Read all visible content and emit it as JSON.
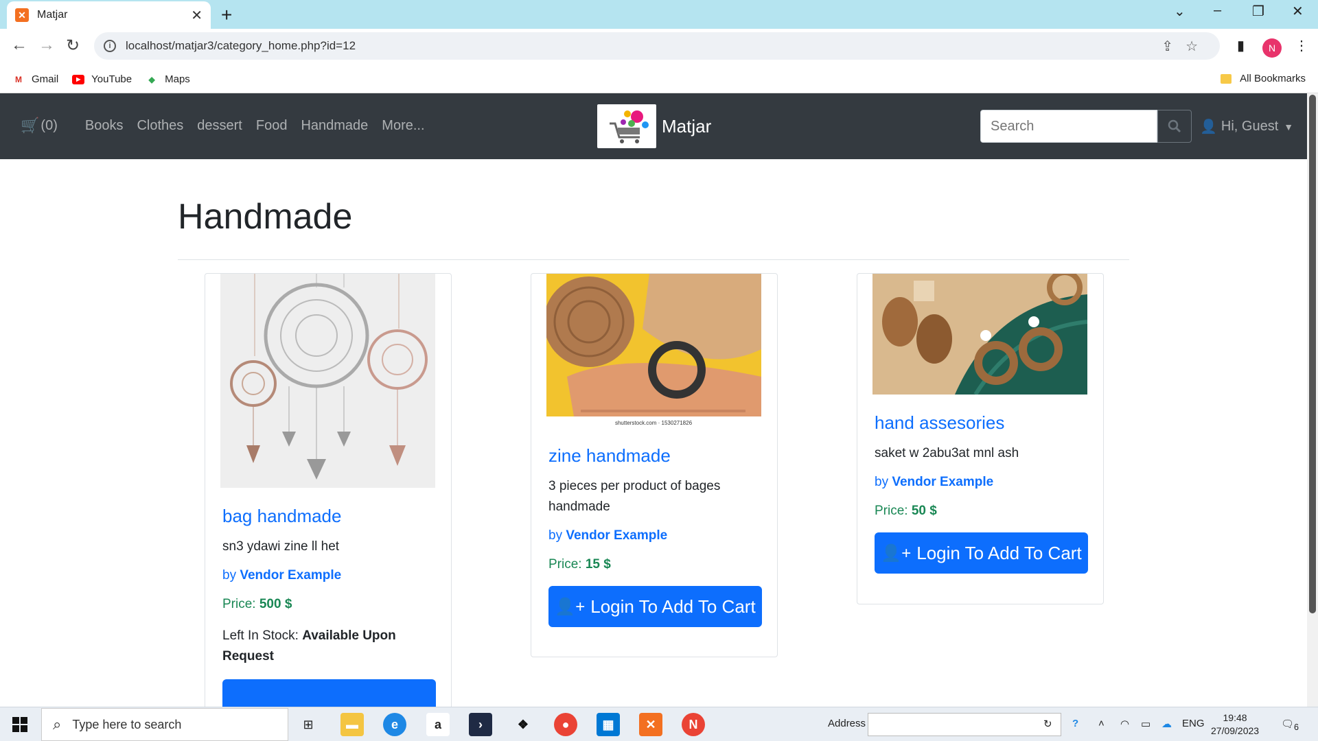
{
  "browser": {
    "tab_title": "Matjar",
    "url": "localhost/matjar3/category_home.php?id=12",
    "bookmarks": [
      {
        "label": "Gmail",
        "icon": "gmail-icon"
      },
      {
        "label": "YouTube",
        "icon": "youtube-icon"
      },
      {
        "label": "Maps",
        "icon": "maps-icon"
      }
    ],
    "all_bookmarks": "All Bookmarks",
    "profile_initial": "N"
  },
  "navbar": {
    "cart_count": "(0)",
    "links": [
      "Books",
      "Clothes",
      "dessert",
      "Food",
      "Handmade",
      "More..."
    ],
    "brand": "Matjar",
    "search_placeholder": "Search",
    "user_greeting": "Hi, Guest"
  },
  "page": {
    "title": "Handmade"
  },
  "products": [
    {
      "title": "bag handmade",
      "description": "sn3 ydawi zine ll het",
      "by_label": "by",
      "vendor": "Vendor Example",
      "price_label": "Price:",
      "price": "500 $",
      "stock_label": "Left In Stock:",
      "stock_value": "Available Upon Request"
    },
    {
      "title": "zine handmade",
      "description": "3 pieces per product of bages handmade",
      "by_label": "by",
      "vendor": "Vendor Example",
      "price_label": "Price:",
      "price": "15 $",
      "button": "Login To Add To Cart",
      "image_caption": "shutterstock.com · 1530271826"
    },
    {
      "title": "hand assesories",
      "description": "saket w 2abu3at mnl ash",
      "by_label": "by",
      "vendor": "Vendor Example",
      "price_label": "Price:",
      "price": "50 $",
      "button": "Login To Add To Cart"
    }
  ],
  "taskbar": {
    "search_placeholder": "Type here to search",
    "address_label": "Address",
    "language": "ENG",
    "time": "19:48",
    "date": "27/09/2023",
    "notification_count": "6"
  },
  "colors": {
    "navbar_bg": "#343a40",
    "primary": "#0d6efd",
    "success": "#198754"
  }
}
